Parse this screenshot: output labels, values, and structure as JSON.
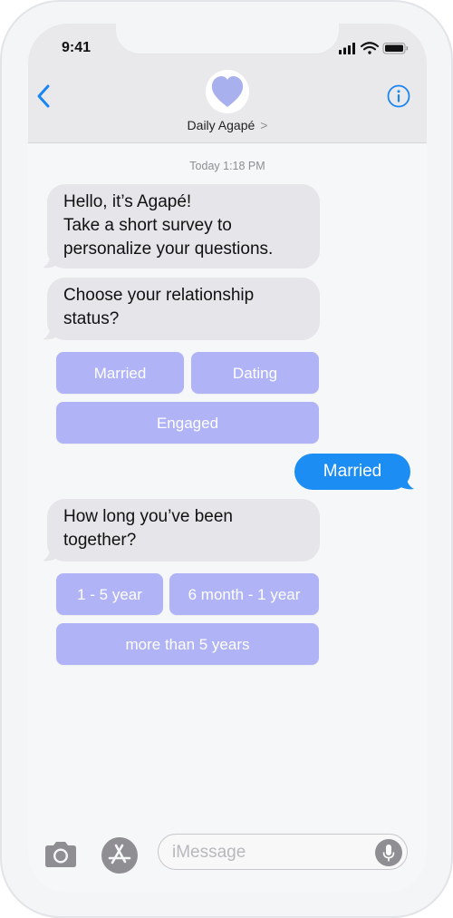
{
  "status_bar": {
    "time": "9:41"
  },
  "header": {
    "contact_name": "Daily Agapé",
    "contact_chevron": ">"
  },
  "conversation": {
    "timestamp": "Today 1:18 PM",
    "msg1_lines": [
      "Hello, it’s Agapé!",
      "Take a short survey to",
      "personalize your questions."
    ],
    "msg2_lines": [
      "Choose your relationship",
      "status?"
    ],
    "status_options": [
      "Married",
      "Dating",
      "Engaged"
    ],
    "sent_reply": "Married",
    "msg3_lines": [
      "How long you’ve been",
      "together?"
    ],
    "duration_options": [
      "1 - 5 year",
      "6 month - 1 year",
      "more than 5 years"
    ]
  },
  "composer": {
    "placeholder": "iMessage"
  },
  "colors": {
    "incoming_bubble": "#e5e5ea",
    "outgoing_bubble": "#1c8df3",
    "quick_reply": "#b0b3f6",
    "ios_blue": "#1a86f0"
  }
}
